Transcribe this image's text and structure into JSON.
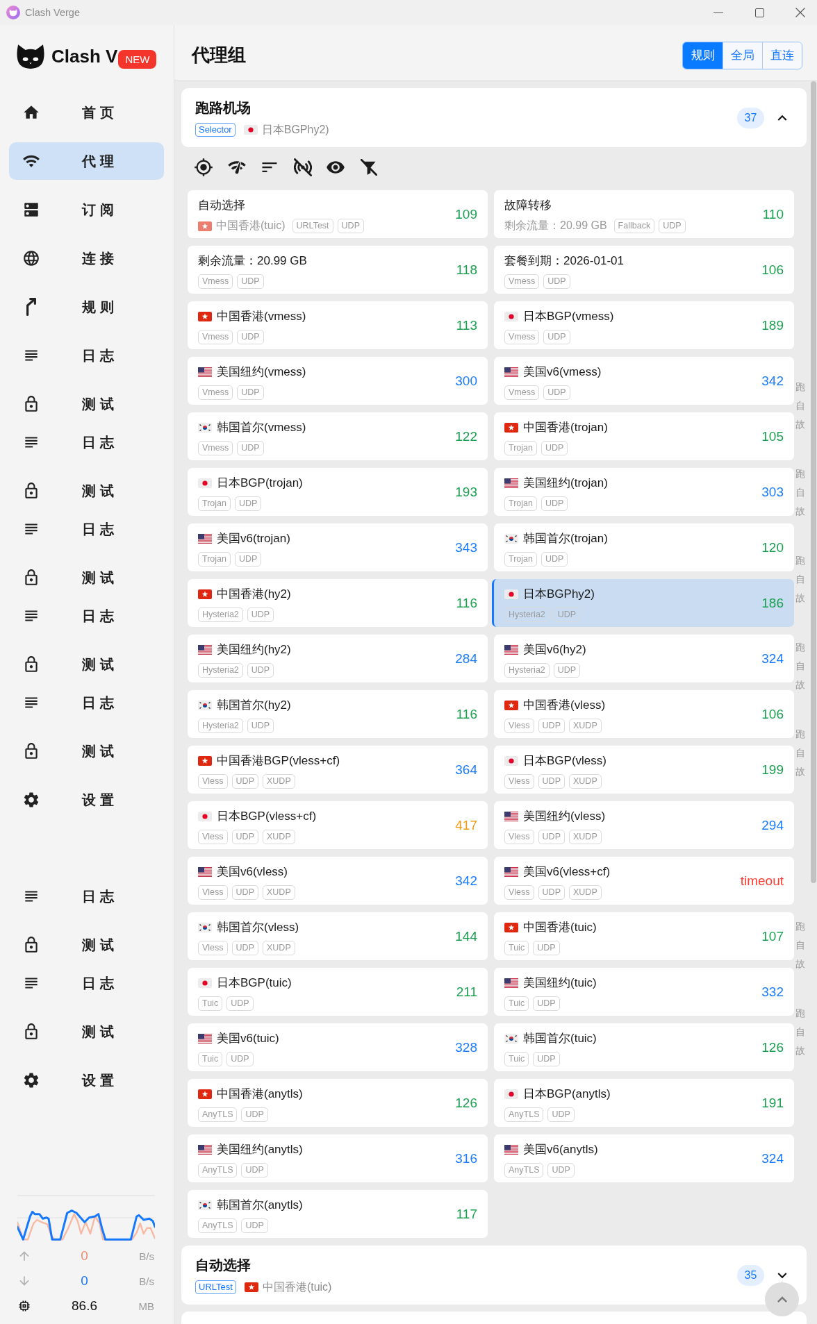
{
  "window": {
    "title": "Clash Verge"
  },
  "sidebar": {
    "logo": {
      "text": "Clash V",
      "badge": "NEW"
    },
    "nav": [
      {
        "label": "首 页",
        "kind": "home",
        "selected": false
      },
      {
        "label": "代 理",
        "kind": "proxy",
        "selected": true
      },
      {
        "label": "订 阅",
        "kind": "subscription",
        "selected": false
      },
      {
        "label": "连 接",
        "kind": "connection",
        "selected": false
      },
      {
        "label": "规 则",
        "kind": "rule",
        "selected": false
      },
      {
        "label": "日 志",
        "kind": "log",
        "selected": false
      },
      {
        "label": "测 试",
        "kind": "test",
        "selected": false
      },
      {
        "label": "日 志",
        "kind": "log",
        "selected": false
      },
      {
        "label": "测 试",
        "kind": "test",
        "selected": false
      },
      {
        "label": "日 志",
        "kind": "log",
        "selected": false
      },
      {
        "label": "测 试",
        "kind": "test",
        "selected": false
      },
      {
        "label": "日 志",
        "kind": "log",
        "selected": false
      },
      {
        "label": "测 试",
        "kind": "test",
        "selected": false
      },
      {
        "label": "日 志",
        "kind": "log",
        "selected": false
      },
      {
        "label": "测 试",
        "kind": "test",
        "selected": false
      },
      {
        "label": "设 置",
        "kind": "setting",
        "selected": false
      },
      {
        "label": "日 志",
        "kind": "log",
        "selected": false
      },
      {
        "label": "测 试",
        "kind": "test",
        "selected": false
      },
      {
        "label": "日 志",
        "kind": "log",
        "selected": false
      },
      {
        "label": "测 试",
        "kind": "test",
        "selected": false
      },
      {
        "label": "设 置",
        "kind": "setting",
        "selected": false
      }
    ],
    "traffic": {
      "upload": {
        "value": "0",
        "unit": "B/s"
      },
      "download": {
        "value": "0",
        "unit": "B/s"
      },
      "memory": {
        "value": "86.6",
        "unit": "MB"
      }
    }
  },
  "header": {
    "title": "代理组",
    "modes": [
      {
        "label": "规则",
        "selected": true
      },
      {
        "label": "全局",
        "selected": false
      },
      {
        "label": "直连",
        "selected": false
      }
    ]
  },
  "groups": [
    {
      "name": "跑路机场",
      "type": "Selector",
      "now_flag": {
        "kind": "jp"
      },
      "now": "日本BGPhy2)",
      "count": "37",
      "expanded": true,
      "proxies": [
        {
          "name": "自动选择",
          "now_flag": {
            "kind": "hk"
          },
          "now": "中国香港(tuic)",
          "tags": [
            "URLTest",
            "UDP"
          ],
          "delay": "109",
          "color": "#1aa050",
          "selected": false
        },
        {
          "name": "故障转移",
          "now": "剩余流量：20.99 GB",
          "tags": [
            "Fallback",
            "UDP"
          ],
          "delay": "110",
          "color": "#1aa050",
          "selected": false
        },
        {
          "name": "剩余流量：20.99 GB",
          "tags": [
            "Vmess",
            "UDP"
          ],
          "delay": "118",
          "color": "#1aa050",
          "selected": false
        },
        {
          "name": "套餐到期：2026-01-01",
          "tags": [
            "Vmess",
            "UDP"
          ],
          "delay": "106",
          "color": "#1aa050",
          "selected": false
        },
        {
          "flag": {
            "kind": "hk"
          },
          "name": "中国香港(vmess)",
          "tags": [
            "Vmess",
            "UDP"
          ],
          "delay": "113",
          "color": "#1aa050",
          "selected": false
        },
        {
          "flag": {
            "kind": "jp"
          },
          "name": "日本BGP(vmess)",
          "tags": [
            "Vmess",
            "UDP"
          ],
          "delay": "189",
          "color": "#1aa050",
          "selected": false
        },
        {
          "flag": {
            "kind": "us"
          },
          "name": "美国纽约(vmess)",
          "tags": [
            "Vmess",
            "UDP"
          ],
          "delay": "300",
          "color": "#1a7cff",
          "selected": false
        },
        {
          "flag": {
            "kind": "us"
          },
          "name": "美国v6(vmess)",
          "tags": [
            "Vmess",
            "UDP"
          ],
          "delay": "342",
          "color": "#1a7cff",
          "selected": false
        },
        {
          "flag": {
            "kind": "kr"
          },
          "name": "韩国首尔(vmess)",
          "tags": [
            "Vmess",
            "UDP"
          ],
          "delay": "122",
          "color": "#1aa050",
          "selected": false
        },
        {
          "flag": {
            "kind": "hk"
          },
          "name": "中国香港(trojan)",
          "tags": [
            "Trojan",
            "UDP"
          ],
          "delay": "105",
          "color": "#1aa050",
          "selected": false
        },
        {
          "flag": {
            "kind": "jp"
          },
          "name": "日本BGP(trojan)",
          "tags": [
            "Trojan",
            "UDP"
          ],
          "delay": "193",
          "color": "#1aa050",
          "selected": false
        },
        {
          "flag": {
            "kind": "us"
          },
          "name": "美国纽约(trojan)",
          "tags": [
            "Trojan",
            "UDP"
          ],
          "delay": "303",
          "color": "#1a7cff",
          "selected": false
        },
        {
          "flag": {
            "kind": "us"
          },
          "name": "美国v6(trojan)",
          "tags": [
            "Trojan",
            "UDP"
          ],
          "delay": "343",
          "color": "#1a7cff",
          "selected": false
        },
        {
          "flag": {
            "kind": "kr"
          },
          "name": "韩国首尔(trojan)",
          "tags": [
            "Trojan",
            "UDP"
          ],
          "delay": "120",
          "color": "#1aa050",
          "selected": false
        },
        {
          "flag": {
            "kind": "hk"
          },
          "name": "中国香港(hy2)",
          "tags": [
            "Hysteria2",
            "UDP"
          ],
          "delay": "116",
          "color": "#1aa050",
          "selected": false
        },
        {
          "flag": {
            "kind": "jp"
          },
          "name": "日本BGPhy2)",
          "tags": [
            "Hysteria2",
            "UDP"
          ],
          "delay": "186",
          "color": "#1aa050",
          "selected": true
        },
        {
          "flag": {
            "kind": "us"
          },
          "name": "美国纽约(hy2)",
          "tags": [
            "Hysteria2",
            "UDP"
          ],
          "delay": "284",
          "color": "#1a7cff",
          "selected": false
        },
        {
          "flag": {
            "kind": "us"
          },
          "name": "美国v6(hy2)",
          "tags": [
            "Hysteria2",
            "UDP"
          ],
          "delay": "324",
          "color": "#1a7cff",
          "selected": false
        },
        {
          "flag": {
            "kind": "kr"
          },
          "name": "韩国首尔(hy2)",
          "tags": [
            "Hysteria2",
            "UDP"
          ],
          "delay": "116",
          "color": "#1aa050",
          "selected": false
        },
        {
          "flag": {
            "kind": "hk"
          },
          "name": "中国香港(vless)",
          "tags": [
            "Vless",
            "UDP",
            "XUDP"
          ],
          "delay": "106",
          "color": "#1aa050",
          "selected": false
        },
        {
          "flag": {
            "kind": "hk"
          },
          "name": "中国香港BGP(vless+cf)",
          "tags": [
            "Vless",
            "UDP",
            "XUDP"
          ],
          "delay": "364",
          "color": "#1a7cff",
          "selected": false
        },
        {
          "flag": {
            "kind": "jp"
          },
          "name": "日本BGP(vless)",
          "tags": [
            "Vless",
            "UDP",
            "XUDP"
          ],
          "delay": "199",
          "color": "#1aa050",
          "selected": false
        },
        {
          "flag": {
            "kind": "jp"
          },
          "name": "日本BGP(vless+cf)",
          "tags": [
            "Vless",
            "UDP",
            "XUDP"
          ],
          "delay": "417",
          "color": "#f39c12",
          "selected": false
        },
        {
          "flag": {
            "kind": "us"
          },
          "name": "美国纽约(vless)",
          "tags": [
            "Vless",
            "UDP",
            "XUDP"
          ],
          "delay": "294",
          "color": "#1a7cff",
          "selected": false
        },
        {
          "flag": {
            "kind": "us"
          },
          "name": "美国v6(vless)",
          "tags": [
            "Vless",
            "UDP",
            "XUDP"
          ],
          "delay": "342",
          "color": "#1a7cff",
          "selected": false
        },
        {
          "flag": {
            "kind": "us"
          },
          "name": "美国v6(vless+cf)",
          "tags": [
            "Vless",
            "UDP",
            "XUDP"
          ],
          "delay": "timeout",
          "color": "#ff3b30",
          "selected": false
        },
        {
          "flag": {
            "kind": "kr"
          },
          "name": "韩国首尔(vless)",
          "tags": [
            "Vless",
            "UDP",
            "XUDP"
          ],
          "delay": "144",
          "color": "#1aa050",
          "selected": false
        },
        {
          "flag": {
            "kind": "hk"
          },
          "name": "中国香港(tuic)",
          "tags": [
            "Tuic",
            "UDP"
          ],
          "delay": "107",
          "color": "#1aa050",
          "selected": false
        },
        {
          "flag": {
            "kind": "jp"
          },
          "name": "日本BGP(tuic)",
          "tags": [
            "Tuic",
            "UDP"
          ],
          "delay": "211",
          "color": "#1aa050",
          "selected": false
        },
        {
          "flag": {
            "kind": "us"
          },
          "name": "美国纽约(tuic)",
          "tags": [
            "Tuic",
            "UDP"
          ],
          "delay": "332",
          "color": "#1a7cff",
          "selected": false
        },
        {
          "flag": {
            "kind": "us"
          },
          "name": "美国v6(tuic)",
          "tags": [
            "Tuic",
            "UDP"
          ],
          "delay": "328",
          "color": "#1a7cff",
          "selected": false
        },
        {
          "flag": {
            "kind": "kr"
          },
          "name": "韩国首尔(tuic)",
          "tags": [
            "Tuic",
            "UDP"
          ],
          "delay": "126",
          "color": "#1aa050",
          "selected": false
        },
        {
          "flag": {
            "kind": "hk"
          },
          "name": "中国香港(anytls)",
          "tags": [
            "AnyTLS",
            "UDP"
          ],
          "delay": "126",
          "color": "#1aa050",
          "selected": false
        },
        {
          "flag": {
            "kind": "jp"
          },
          "name": "日本BGP(anytls)",
          "tags": [
            "AnyTLS",
            "UDP"
          ],
          "delay": "191",
          "color": "#1aa050",
          "selected": false
        },
        {
          "flag": {
            "kind": "us"
          },
          "name": "美国纽约(anytls)",
          "tags": [
            "AnyTLS",
            "UDP"
          ],
          "delay": "316",
          "color": "#1a7cff",
          "selected": false
        },
        {
          "flag": {
            "kind": "us"
          },
          "name": "美国v6(anytls)",
          "tags": [
            "AnyTLS",
            "UDP"
          ],
          "delay": "324",
          "color": "#1a7cff",
          "selected": false
        },
        {
          "flag": {
            "kind": "kr"
          },
          "name": "韩国首尔(anytls)",
          "tags": [
            "AnyTLS",
            "UDP"
          ],
          "delay": "117",
          "color": "#1aa050",
          "selected": false
        }
      ]
    },
    {
      "name": "自动选择",
      "type": "URLTest",
      "now_flag": {
        "kind": "hk"
      },
      "now": "中国香港(tuic)",
      "count": "35",
      "expanded": false
    }
  ],
  "side_labels": [
    "跑自故",
    "跑自故",
    "跑自故",
    "跑自故",
    "跑自故",
    "跑自故",
    "跑自故"
  ]
}
